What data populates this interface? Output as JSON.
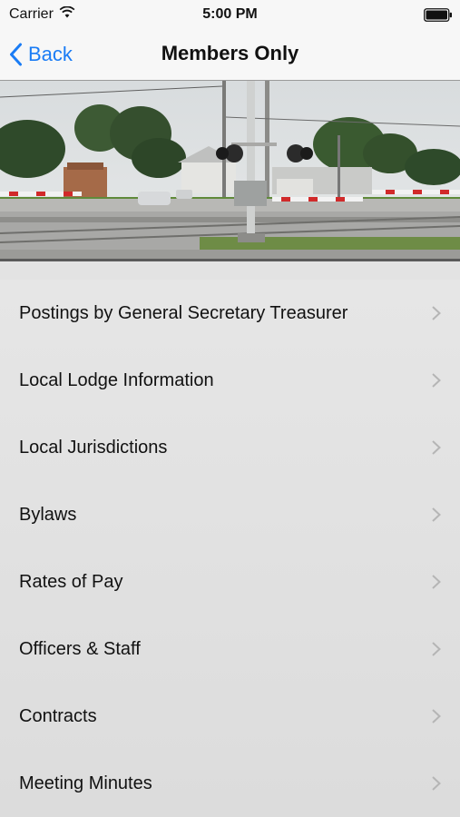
{
  "status_bar": {
    "carrier": "Carrier",
    "time": "5:00 PM",
    "icons": [
      "wifi-icon",
      "battery-icon"
    ]
  },
  "nav": {
    "back_label": "Back",
    "title": "Members Only",
    "accent_color": "#1a7cf5"
  },
  "hero": {
    "icon": "railroad-crossing-photo"
  },
  "menu": {
    "items": [
      {
        "label": "Postings by General Secretary Treasurer"
      },
      {
        "label": "Local Lodge Information"
      },
      {
        "label": "Local Jurisdictions"
      },
      {
        "label": "Bylaws"
      },
      {
        "label": "Rates of Pay"
      },
      {
        "label": "Officers & Staff"
      },
      {
        "label": "Contracts"
      },
      {
        "label": "Meeting Minutes"
      }
    ],
    "chevron_icon": "chevron-right-icon"
  }
}
